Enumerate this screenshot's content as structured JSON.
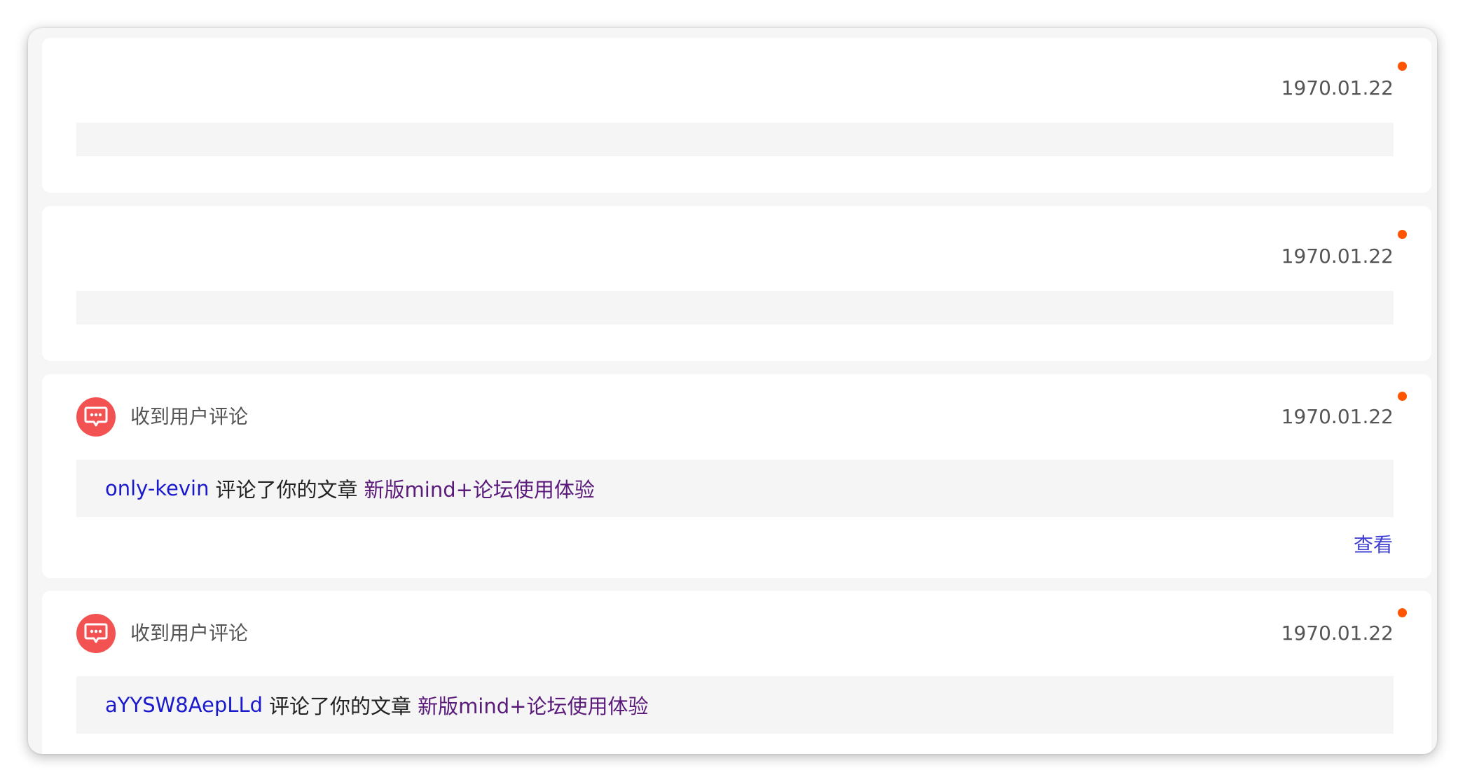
{
  "colors": {
    "unread_dot": "#ff5500",
    "icon_bg": "#f25252",
    "user_link": "#1a1acc",
    "article_link": "#5a1a7a",
    "view_link": "#4040d0"
  },
  "notifications": [
    {
      "date": "1970.01.22",
      "unread": true
    },
    {
      "date": "1970.01.22",
      "unread": true
    },
    {
      "icon": "comment-icon",
      "type_label": "收到用户评论",
      "date": "1970.01.22",
      "unread": true,
      "user": "only-kevin",
      "action_text": "评论了你的文章",
      "article": "新版mind+论坛使用体验",
      "view_label": "查看"
    },
    {
      "icon": "comment-icon",
      "type_label": "收到用户评论",
      "date": "1970.01.22",
      "unread": true,
      "user": "aYYSW8AepLLd",
      "action_text": "评论了你的文章",
      "article": "新版mind+论坛使用体验"
    }
  ]
}
